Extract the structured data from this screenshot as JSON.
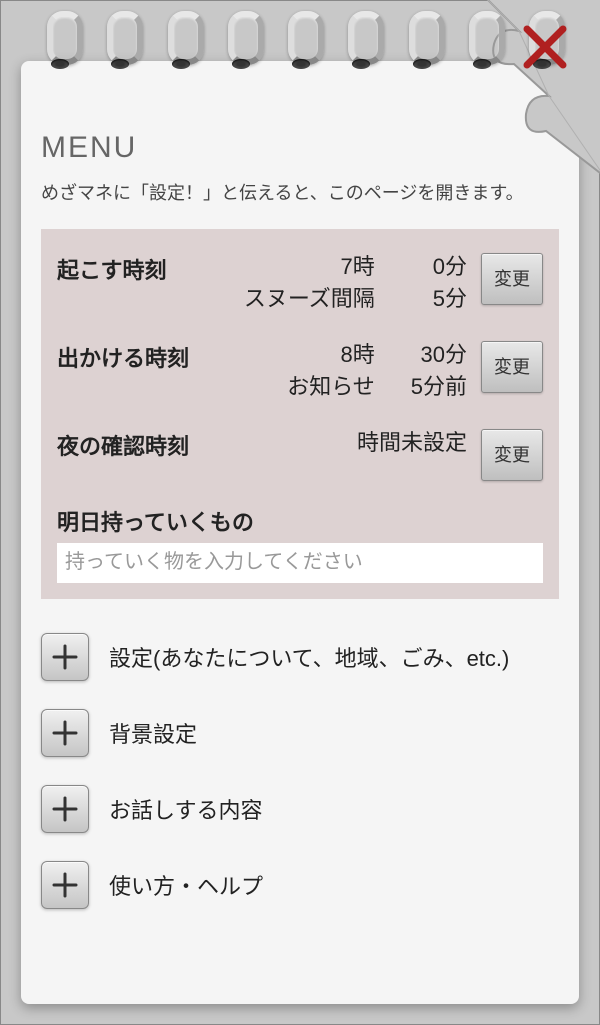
{
  "header": {
    "title": "MENU",
    "subtitle": "めざマネに「設定！」と伝えると、このページを開きます。"
  },
  "settings": {
    "wake": {
      "label": "起こす時刻",
      "time_hour": "7時",
      "time_min": "0分",
      "snooze_label": "スヌーズ間隔",
      "snooze_value": "5分",
      "change": "変更"
    },
    "leave": {
      "label": "出かける時刻",
      "time_hour": "8時",
      "time_min": "30分",
      "notify_label": "お知らせ",
      "notify_value": "5分前",
      "change": "変更"
    },
    "night": {
      "label": "夜の確認時刻",
      "value": "時間未設定",
      "change": "変更"
    },
    "bring": {
      "label": "明日持っていくもの",
      "placeholder": "持っていく物を入力してください"
    }
  },
  "menu": {
    "items": [
      {
        "label": "設定(あなたについて、地域、ごみ、etc.)"
      },
      {
        "label": "背景設定"
      },
      {
        "label": "お話しする内容"
      },
      {
        "label": "使い方・ヘルプ"
      }
    ]
  }
}
